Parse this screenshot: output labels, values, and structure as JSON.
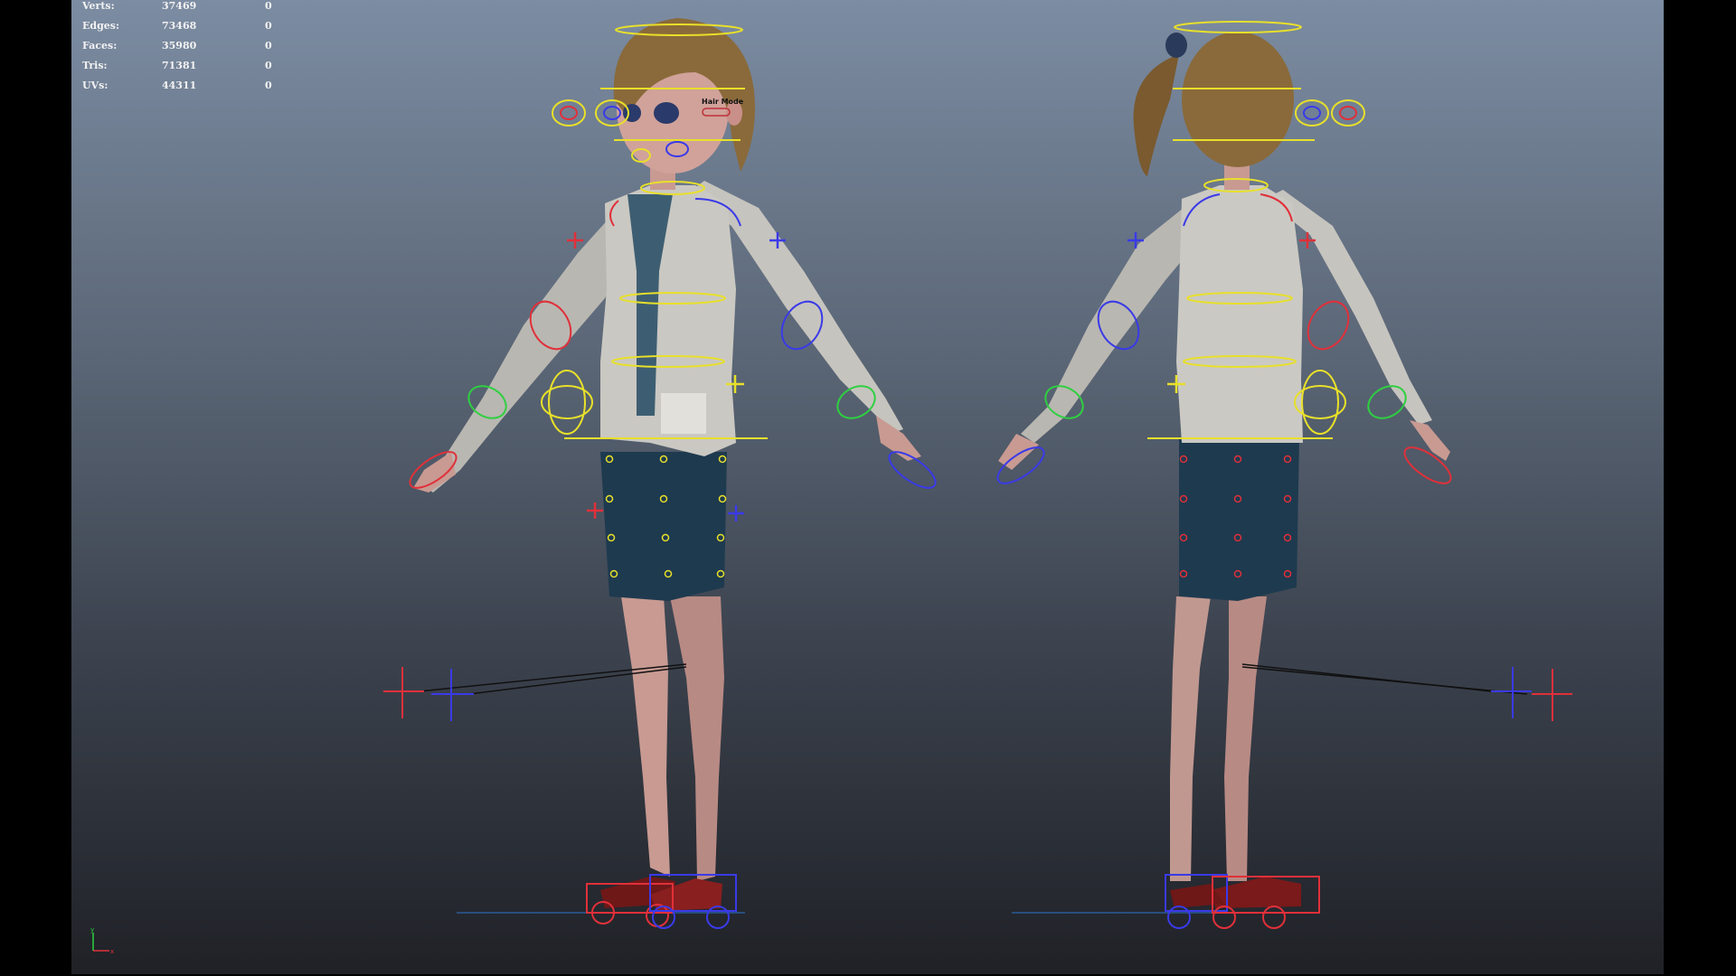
{
  "app": "Maya viewport",
  "hud": {
    "rows": [
      {
        "label": "Verts:",
        "value": "37469",
        "sel": "0"
      },
      {
        "label": "Edges:",
        "value": "73468",
        "sel": "0"
      },
      {
        "label": "Faces:",
        "value": "35980",
        "sel": "0"
      },
      {
        "label": "Tris:",
        "value": "71381",
        "sel": "0"
      },
      {
        "label": "UVs:",
        "value": "44311",
        "sel": "0"
      }
    ]
  },
  "controls": {
    "hair_mode_label": "Hair Mode"
  },
  "gizmo": {
    "x_label": "x",
    "y_label": "y"
  },
  "colors": {
    "ctrl_yellow": "#e8e02a",
    "ctrl_red": "#e0303a",
    "ctrl_blue": "#3a3ae8",
    "ctrl_green": "#2ed040",
    "jacket": "#c8c6c0",
    "skirt": "#1f3a50",
    "skin": "#c99a94",
    "hair": "#8a6a3a",
    "shoes": "#7a1a1a"
  }
}
